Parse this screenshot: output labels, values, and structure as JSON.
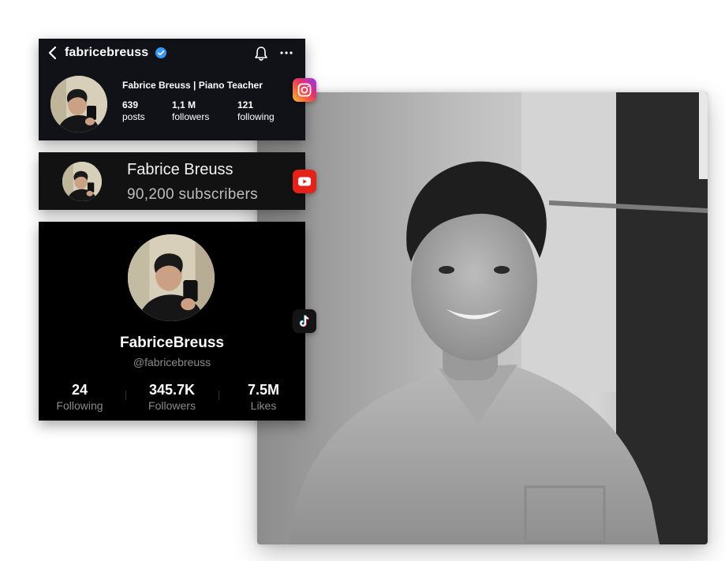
{
  "instagram": {
    "username": "fabricebreuss",
    "display_name": "Fabrice Breuss | Piano Teacher",
    "stats": [
      {
        "value": "639",
        "label": "posts"
      },
      {
        "value": "1,1 M",
        "label": "followers"
      },
      {
        "value": "121",
        "label": "following"
      }
    ],
    "icons": [
      "chevron-left-icon",
      "verified-badge-icon",
      "bell-icon",
      "more-icon"
    ],
    "badge_color": "#e1306c"
  },
  "youtube": {
    "name": "Fabrice Breuss",
    "subscribers": "90,200 subscribers",
    "badge_color": "#e62117"
  },
  "tiktok": {
    "name": "FabriceBreuss",
    "handle": "@fabricebreuss",
    "stats": [
      {
        "value": "24",
        "label": "Following"
      },
      {
        "value": "345.7K",
        "label": "Followers"
      },
      {
        "value": "7.5M",
        "label": "Likes"
      }
    ],
    "badge_color": "#141414"
  },
  "colors": {
    "verified": "#3897f0",
    "card_dark": "#101218"
  }
}
